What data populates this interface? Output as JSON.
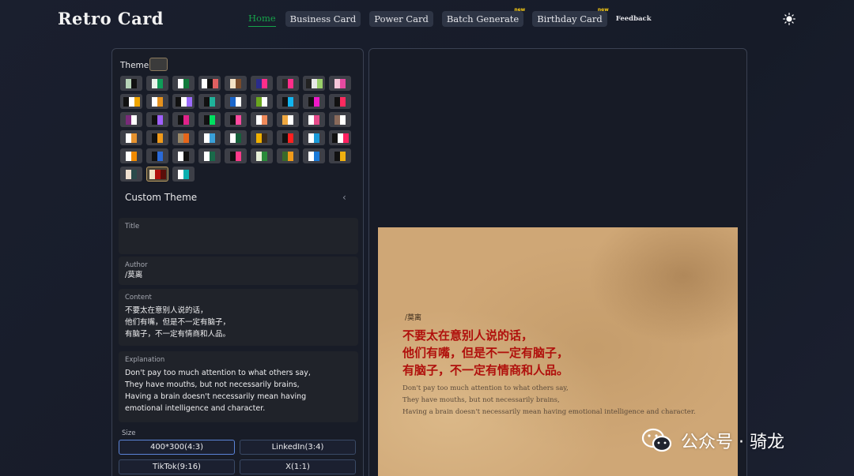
{
  "app": {
    "title": "Retro Card"
  },
  "nav": {
    "items": [
      {
        "label": "Home",
        "active": true,
        "new": false
      },
      {
        "label": "Business Card",
        "new": false
      },
      {
        "label": "Power Card",
        "new": false
      },
      {
        "label": "Batch Generate",
        "new": true
      },
      {
        "label": "Birthday Card",
        "new": true
      },
      {
        "label": "Feedback",
        "new": false
      }
    ],
    "new_badge": "new",
    "theme_toggle_icon": "sun-icon"
  },
  "theme": {
    "label": "Theme",
    "current": [
      "#f2e2c6",
      "#b0100c",
      "#5a0e0a"
    ],
    "swatches": [
      [
        "#b8d4b8",
        "#111111"
      ],
      [
        "#e8f3ea",
        "#0f9d58"
      ],
      [
        "#ffffff",
        "#0f7a3a"
      ],
      [
        "#ffffff",
        "#111111",
        "#e06060"
      ],
      [
        "#f3e2c6",
        "#7a4b2a"
      ],
      [
        "#2a2c8c",
        "#ff2e8a"
      ],
      [
        "#2a2a2a",
        "#ff2e8a"
      ],
      [
        "#222222",
        "#e8e8e8",
        "#9ad06a"
      ],
      [
        "#f5c6d8",
        "#e64aa0"
      ],
      [
        "#111111",
        "#ffffff",
        "#f0a500"
      ],
      [
        "#ffffff",
        "#e6921e"
      ],
      [
        "#111111",
        "#ffffff",
        "#9b6bff"
      ],
      [
        "#111111",
        "#1fb39a"
      ],
      [
        "#1a66cc",
        "#ffffff"
      ],
      [
        "#6aa61e",
        "#ffffff"
      ],
      [
        "#111111",
        "#12b5f0"
      ],
      [
        "#111111",
        "#f019c8"
      ],
      [
        "#111111",
        "#ff2a5f"
      ],
      [
        "#7a2a7a",
        "#ffffff"
      ],
      [
        "#111111",
        "#a060ff"
      ],
      [
        "#111111",
        "#e0228a"
      ],
      [
        "#111111",
        "#00e060"
      ],
      [
        "#111111",
        "#ff4aa0"
      ],
      [
        "#ffffff",
        "#f08a5a"
      ],
      [
        "#f0a840",
        "#ffffff"
      ],
      [
        "#ffffff",
        "#e64a8a"
      ],
      [
        "#8a6a5a",
        "#ffffff"
      ],
      [
        "#ffffff",
        "#e6922e"
      ],
      [
        "#111111",
        "#f09a1a"
      ],
      [
        "#9a8a6a",
        "#e6661a"
      ],
      [
        "#ffffff",
        "#3aa0d8"
      ],
      [
        "#ffffff",
        "#14603a"
      ],
      [
        "#f0b000",
        "#3a2a1a"
      ],
      [
        "#111111",
        "#ff2020"
      ],
      [
        "#ffffff",
        "#1a9ad8"
      ],
      [
        "#111111",
        "#ffffff",
        "#ff2060"
      ],
      [
        "#ffffff",
        "#f08a00"
      ],
      [
        "#111111",
        "#2a6ad8"
      ],
      [
        "#ffffff",
        "#111111"
      ],
      [
        "#ffffff",
        "#1a6a4a"
      ],
      [
        "#111111",
        "#ff3a8a"
      ],
      [
        "#e8f0d8",
        "#2a8a3a"
      ],
      [
        "#3a6a2a",
        "#f09a1a"
      ],
      [
        "#ffffff",
        "#1a7ad8"
      ],
      [
        "#111111",
        "#f0b010"
      ],
      [
        "#f0e0d0",
        "#2a4a4a"
      ],
      [
        "#f2e2c6",
        "#b0100c",
        "#5a0e0a"
      ],
      [
        "#ffffff",
        "#0ab0b0"
      ]
    ],
    "selected_index": 46,
    "custom_label": "Custom Theme"
  },
  "fields": {
    "title": {
      "label": "Title",
      "value": ""
    },
    "author": {
      "label": "Author",
      "value": "/莫离"
    },
    "content": {
      "label": "Content",
      "value": "不要太在意别人说的话，\n他们有嘴，但是不一定有脑子，\n有脑子，不一定有情商和人品。"
    },
    "explanation": {
      "label": "Explanation",
      "value": "Don't pay too much attention to what others say,\nThey have mouths, but not necessarily brains,\nHaving a brain doesn't necessarily mean having\nemotional intelligence and character."
    }
  },
  "size": {
    "label": "Size",
    "options": [
      "400*300(4:3)",
      "LinkedIn(3:4)",
      "TikTok(9:16)",
      "X(1:1)"
    ],
    "selected": "400*300(4:3)"
  },
  "card": {
    "author": "/莫离",
    "content": "不要太在意别人说的话，\n他们有嘴，但是不一定有脑子，\n有脑子，不一定有情商和人品。",
    "explanation": "Don't pay too much attention to what others say,\nThey have mouths, but not necessarily brains,\nHaving a brain doesn't necessarily mean having emotional intelligence and character."
  },
  "watermark": {
    "text": "公众号 · 骑龙",
    "icon": "wechat-icon"
  }
}
